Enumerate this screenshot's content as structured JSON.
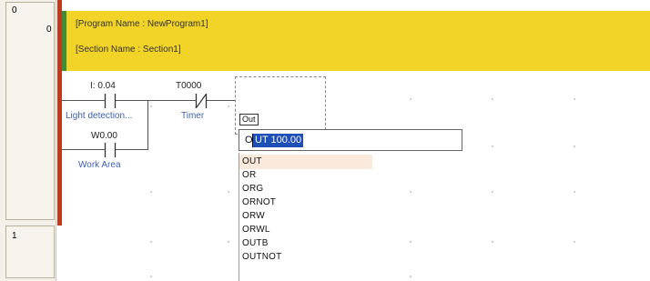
{
  "rungs": [
    {
      "left_number": "0",
      "right_number": "0"
    },
    {
      "left_number": "1"
    }
  ],
  "header": {
    "program_name": "[Program Name : NewProgram1]",
    "section_name": "[Section Name : Section1]"
  },
  "contacts": [
    {
      "address": "I: 0.04",
      "comment": "Light detection...",
      "type": "normally-open"
    },
    {
      "address": "T0000",
      "comment": "Timer",
      "type": "normally-closed"
    },
    {
      "address": "W0.00",
      "comment": "Work Area",
      "type": "normally-open"
    }
  ],
  "instruction_entry": {
    "tag": "Out",
    "typed_prefix": "O",
    "selected_text": "UT 100.00"
  },
  "suggestions": [
    "OUT",
    "OR",
    "ORG",
    "ORNOT",
    "ORW",
    "ORWL",
    "OUTB",
    "OUTNOT"
  ],
  "colors": {
    "power_rail": "#c0391b",
    "header_band": "#f2d327",
    "header_marker": "#3c8c3c",
    "comment_text": "#3f61b0",
    "selection": "#1d4fb6"
  }
}
